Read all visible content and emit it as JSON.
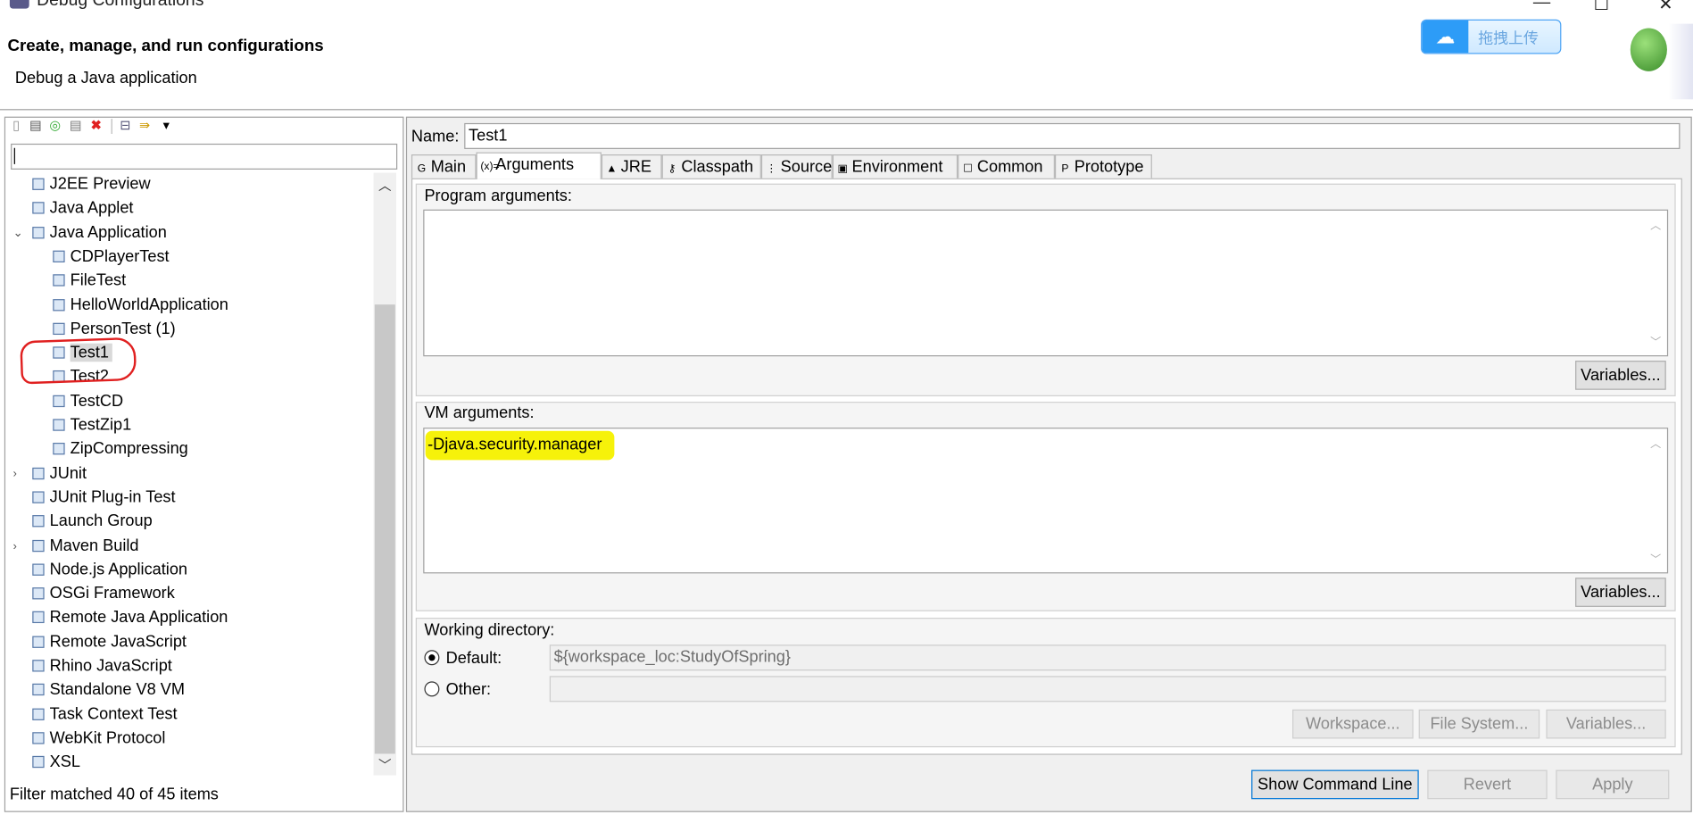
{
  "window": {
    "title": "Debug Configurations",
    "controls": [
      "minimize",
      "maximize",
      "close"
    ]
  },
  "header": {
    "title": "Create, manage, and run configurations",
    "subtitle": "Debug a Java application",
    "upload_button": "拖拽上传"
  },
  "left": {
    "toolbar": [
      "new-config-icon",
      "new-prototype-icon",
      "export-icon",
      "duplicate-icon",
      "delete-icon",
      "collapse-all-icon",
      "filter-icon",
      "view-menu-icon"
    ],
    "filter_value": "",
    "tree": [
      {
        "label": "J2EE Preview",
        "level": 0
      },
      {
        "label": "Java Applet",
        "level": 0
      },
      {
        "label": "Java Application",
        "level": 0,
        "expanded": true
      },
      {
        "label": "CDPlayerTest",
        "level": 1
      },
      {
        "label": "FileTest",
        "level": 1
      },
      {
        "label": "HelloWorldApplication",
        "level": 1
      },
      {
        "label": "PersonTest (1)",
        "level": 1
      },
      {
        "label": "Test1",
        "level": 1,
        "selected": true
      },
      {
        "label": "Test2",
        "level": 1
      },
      {
        "label": "TestCD",
        "level": 1
      },
      {
        "label": "TestZip1",
        "level": 1
      },
      {
        "label": "ZipCompressing",
        "level": 1
      },
      {
        "label": "JUnit",
        "level": 0,
        "expanded": false
      },
      {
        "label": "JUnit Plug-in Test",
        "level": 0
      },
      {
        "label": "Launch Group",
        "level": 0
      },
      {
        "label": "Maven Build",
        "level": 0,
        "expanded": false
      },
      {
        "label": "Node.js Application",
        "level": 0
      },
      {
        "label": "OSGi Framework",
        "level": 0
      },
      {
        "label": "Remote Java Application",
        "level": 0
      },
      {
        "label": "Remote JavaScript",
        "level": 0
      },
      {
        "label": "Rhino JavaScript",
        "level": 0
      },
      {
        "label": "Standalone V8 VM",
        "level": 0
      },
      {
        "label": "Task Context Test",
        "level": 0
      },
      {
        "label": "WebKit Protocol",
        "level": 0
      },
      {
        "label": "XSL",
        "level": 0
      }
    ],
    "status": "Filter matched 40 of 45 items"
  },
  "right": {
    "name_label": "Name:",
    "name_value": "Test1",
    "tabs": [
      {
        "label": "Main",
        "icon": "G"
      },
      {
        "label": "Arguments",
        "icon": "(x)=",
        "active": true
      },
      {
        "label": "JRE",
        "icon": "▲"
      },
      {
        "label": "Classpath",
        "icon": "⚷"
      },
      {
        "label": "Source",
        "icon": "⋮"
      },
      {
        "label": "Environment",
        "icon": "▣"
      },
      {
        "label": "Common",
        "icon": "☐"
      },
      {
        "label": "Prototype",
        "icon": "P"
      }
    ],
    "program_args": {
      "label": "Program arguments:",
      "value": "",
      "variables": "Variables..."
    },
    "vm_args": {
      "label": "VM arguments:",
      "value": "-Djava.security.manager",
      "variables": "Variables..."
    },
    "working_dir": {
      "label": "Working directory:",
      "default_label": "Default:",
      "default_value": "${workspace_loc:StudyOfSpring}",
      "other_label": "Other:",
      "other_value": "",
      "selected": "default",
      "workspace": "Workspace...",
      "file_system": "File System...",
      "variables": "Variables..."
    },
    "buttons": {
      "show_command_line": "Show Command Line",
      "revert": "Revert",
      "apply": "Apply"
    }
  },
  "colors": {
    "highlight": "#f6f20a",
    "annotation": "#e02020",
    "accent": "#2d9cf7"
  }
}
